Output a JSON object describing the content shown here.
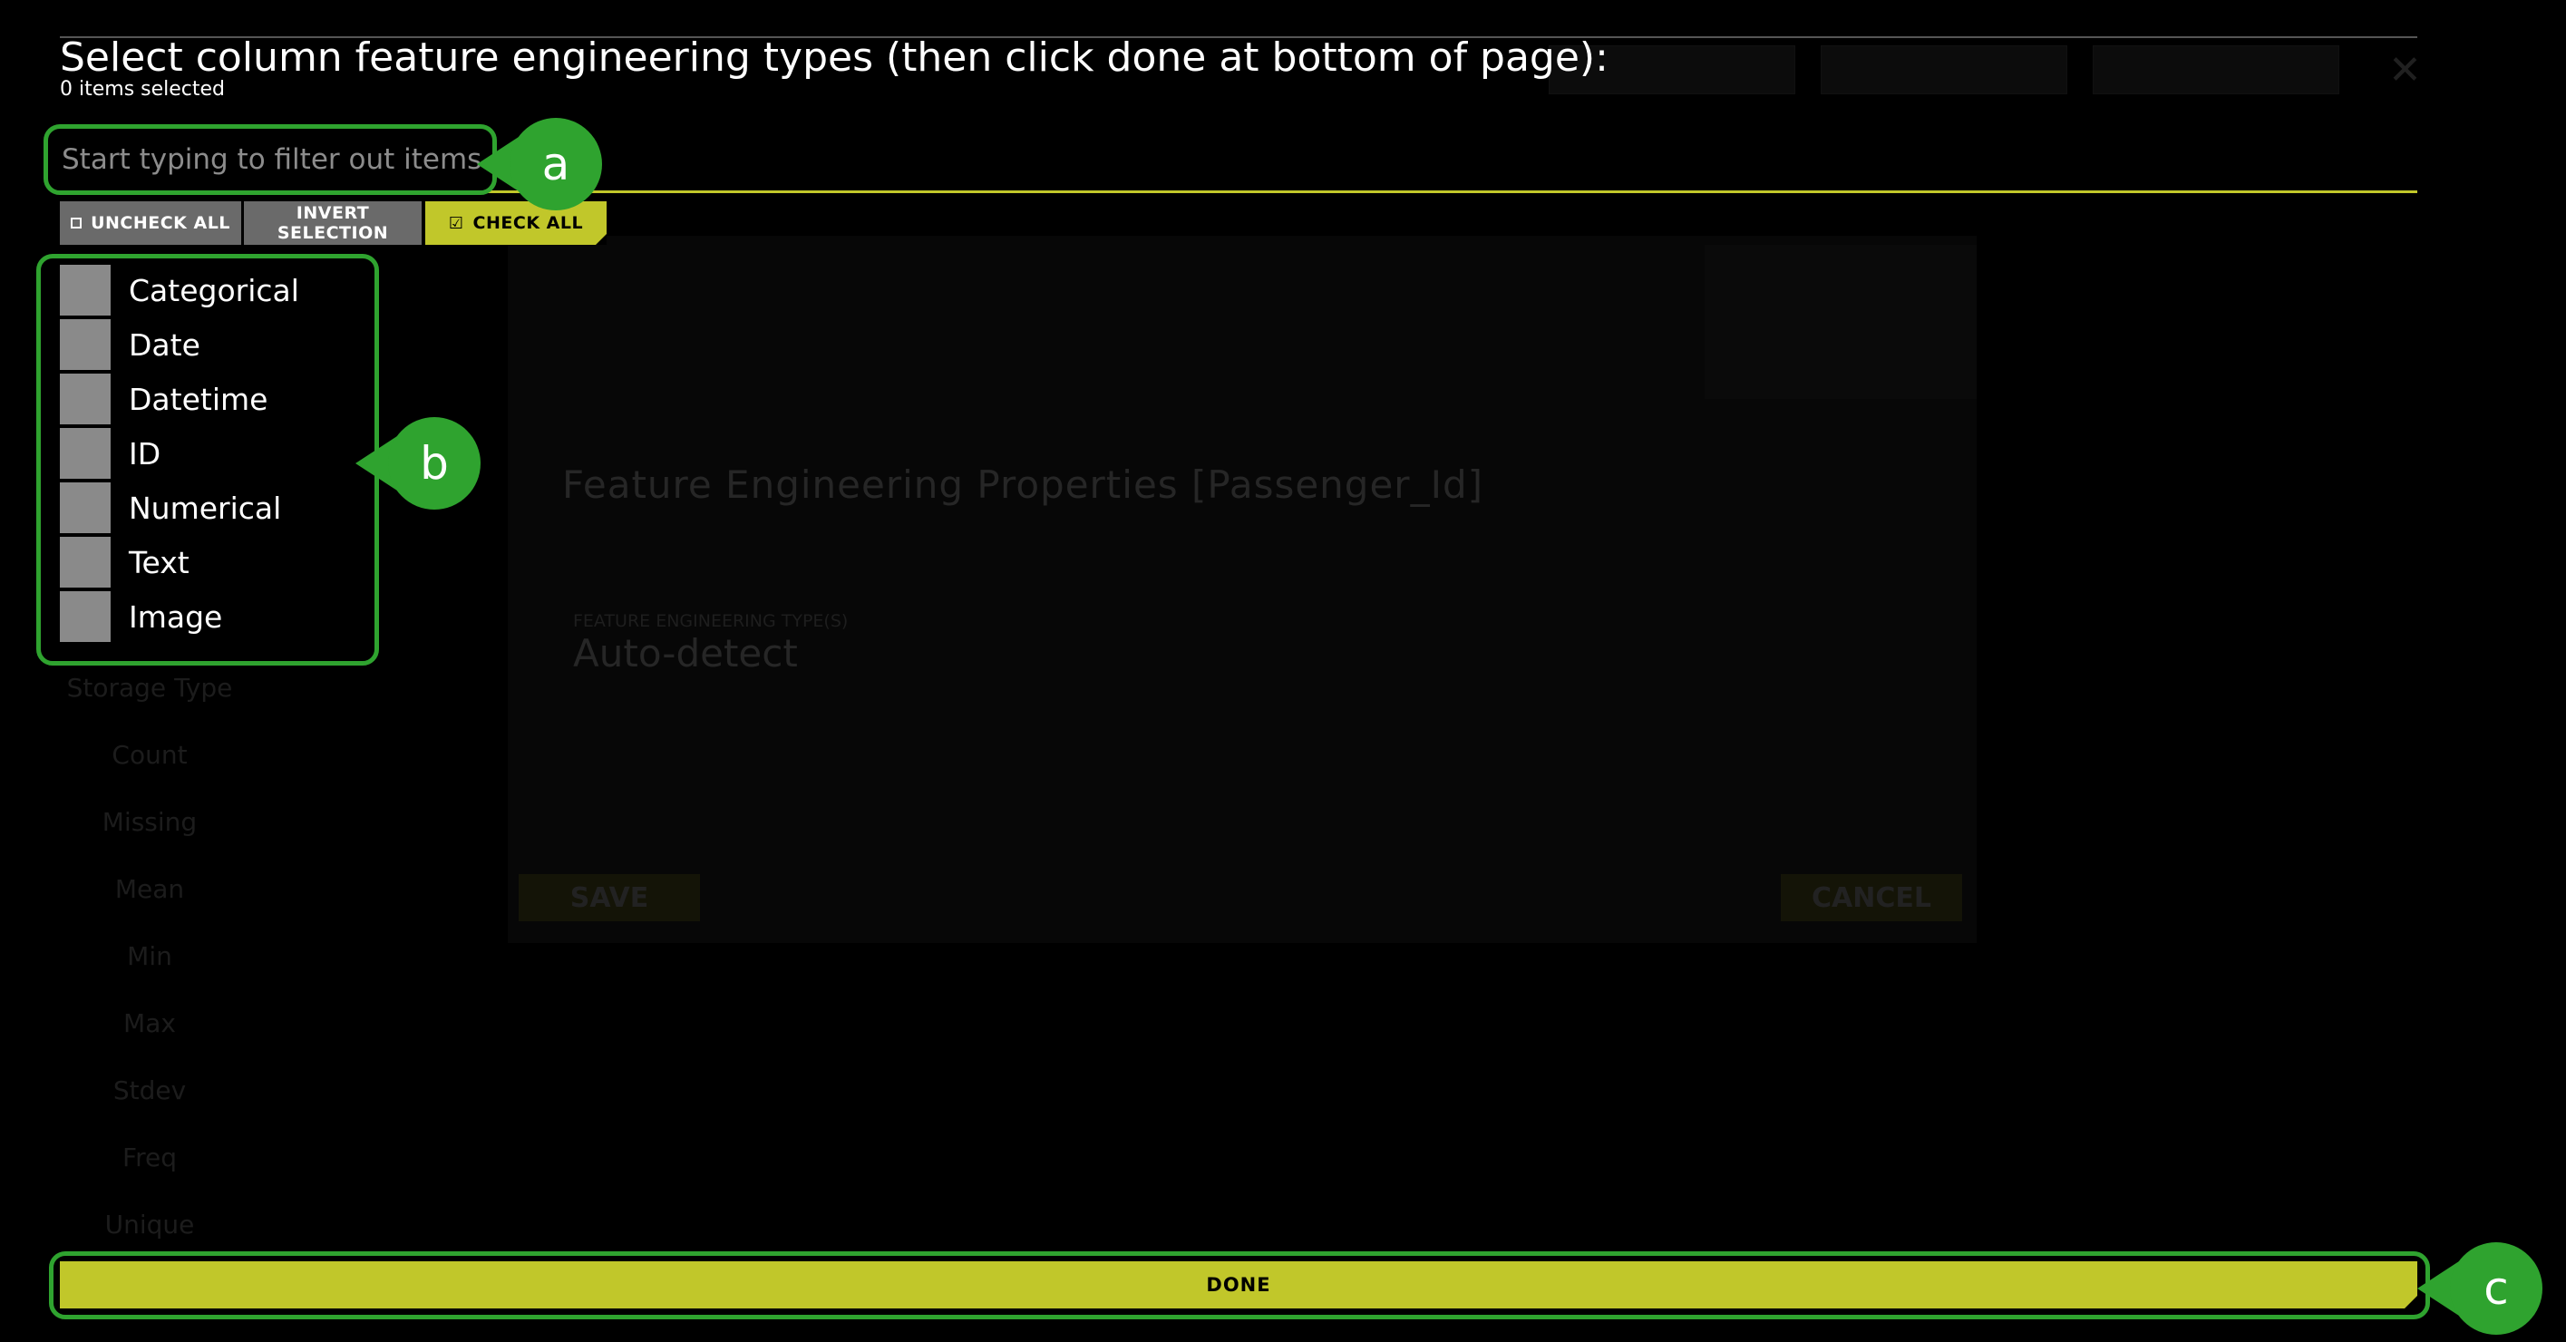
{
  "modal": {
    "title": "Select column feature engineering types (then click done at bottom of page):",
    "selected_count_text": "0 items selected",
    "filter_placeholder": "Start typing to filter out items",
    "buttons": {
      "uncheck_all": "UNCHECK ALL",
      "invert_selection": "INVERT SELECTION",
      "check_all": "CHECK ALL"
    },
    "items": [
      {
        "label": "Categorical",
        "checked": false
      },
      {
        "label": "Date",
        "checked": false
      },
      {
        "label": "Datetime",
        "checked": false
      },
      {
        "label": "ID",
        "checked": false
      },
      {
        "label": "Numerical",
        "checked": false
      },
      {
        "label": "Text",
        "checked": false
      },
      {
        "label": "Image",
        "checked": false
      }
    ],
    "done_label": "DONE"
  },
  "background": {
    "dialog_title": "Feature Engineering Properties [Passenger_Id]",
    "fe_types_label": "FEATURE ENGINEERING TYPE(S)",
    "fe_types_value": "Auto-detect",
    "save_label": "SAVE",
    "cancel_label": "CANCEL",
    "stat_labels": [
      "Storage Type",
      "Count",
      "Missing",
      "Mean",
      "Min",
      "Max",
      "Stdev",
      "Freq",
      "Unique"
    ]
  },
  "annotations": {
    "a": "a",
    "b": "b",
    "c": "c"
  },
  "colors": {
    "accent": "#c1c72a",
    "annotation": "#2fa32f",
    "checkbox": "#8a8a8a",
    "secondary_button": "#6a6a6a"
  }
}
